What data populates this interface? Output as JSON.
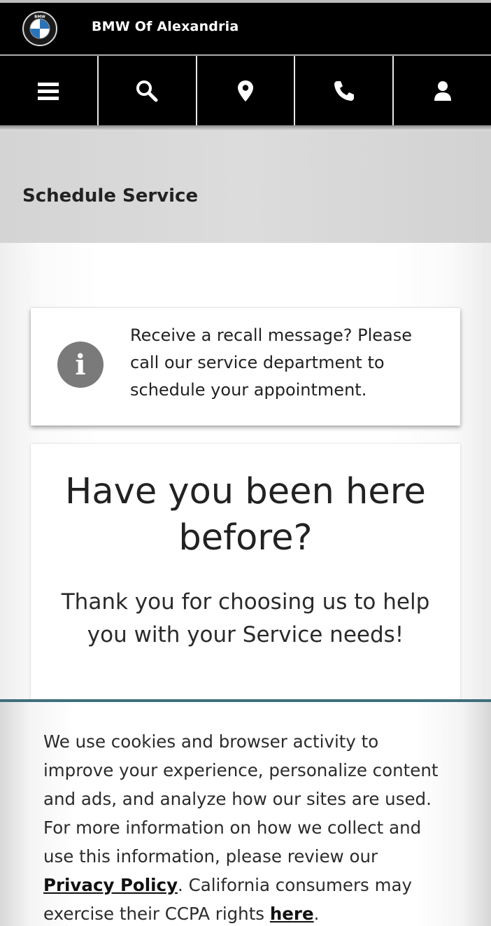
{
  "header": {
    "dealer_name": "BMW Of Alexandria",
    "logo_letters": "BMW"
  },
  "nav": {
    "items": [
      {
        "name": "menu",
        "icon": "hamburger-icon"
      },
      {
        "name": "search",
        "icon": "search-icon"
      },
      {
        "name": "location",
        "icon": "map-pin-icon"
      },
      {
        "name": "phone",
        "icon": "phone-icon"
      },
      {
        "name": "account",
        "icon": "user-icon"
      }
    ],
    "icon_color": "#ffffff",
    "background": "#000000"
  },
  "page": {
    "title": "Schedule Service"
  },
  "recall": {
    "icon_letter": "i",
    "message": "Receive a recall message? Please call our service department to schedule your appointment."
  },
  "visit": {
    "heading": "Have you been here before?",
    "subtext": "Thank you for choosing us to help you with your Service needs!"
  },
  "cookie": {
    "text_before": "We use cookies and browser activity to improve your experience, personalize content and ads, and analyze how our sites are used. For more information on how we collect and use this information, please review our ",
    "privacy_link": "Privacy Policy",
    "text_middle": ". California consumers may exercise their CCPA rights ",
    "ccpa_link": "here",
    "text_after": ".",
    "accent_color": "#3d6f7a"
  }
}
